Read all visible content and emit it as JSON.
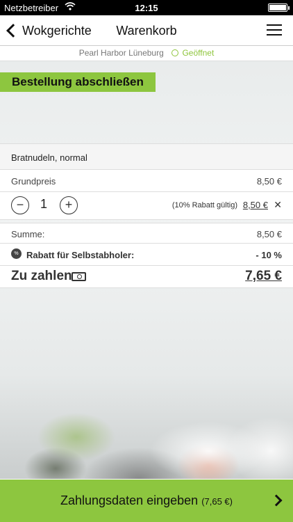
{
  "status_bar": {
    "carrier": "Netzbetreiber",
    "time": "12:15"
  },
  "nav": {
    "back_label": "Wokgerichte",
    "title": "Warenkorb"
  },
  "restaurant": {
    "name": "Pearl Harbor Lüneburg",
    "status": "Geöffnet"
  },
  "order_button": "Bestellung abschließen",
  "cart": {
    "item_name": "Bratnudeln, normal",
    "base_price_label": "Grundpreis",
    "base_price": "8,50 €",
    "quantity": "1",
    "minus_symbol": "−",
    "plus_symbol": "+",
    "remove_symbol": "✕",
    "discount_note": "(10% Rabatt gültig)",
    "line_price": "8,50 €"
  },
  "totals": {
    "sum_label": "Summe:",
    "sum_value": "8,50 €",
    "discount_badge": "%",
    "discount_label": "Rabatt für Selbstabholer:",
    "discount_value": "- 10 %",
    "pay_label": "Zu zahlen",
    "pay_value": "7,65 €"
  },
  "footer": {
    "label": "Zahlungsdaten eingeben",
    "amount": "(7,65 €)"
  },
  "colors": {
    "accent": "#8dc63f",
    "open_status": "#8ec53c"
  }
}
